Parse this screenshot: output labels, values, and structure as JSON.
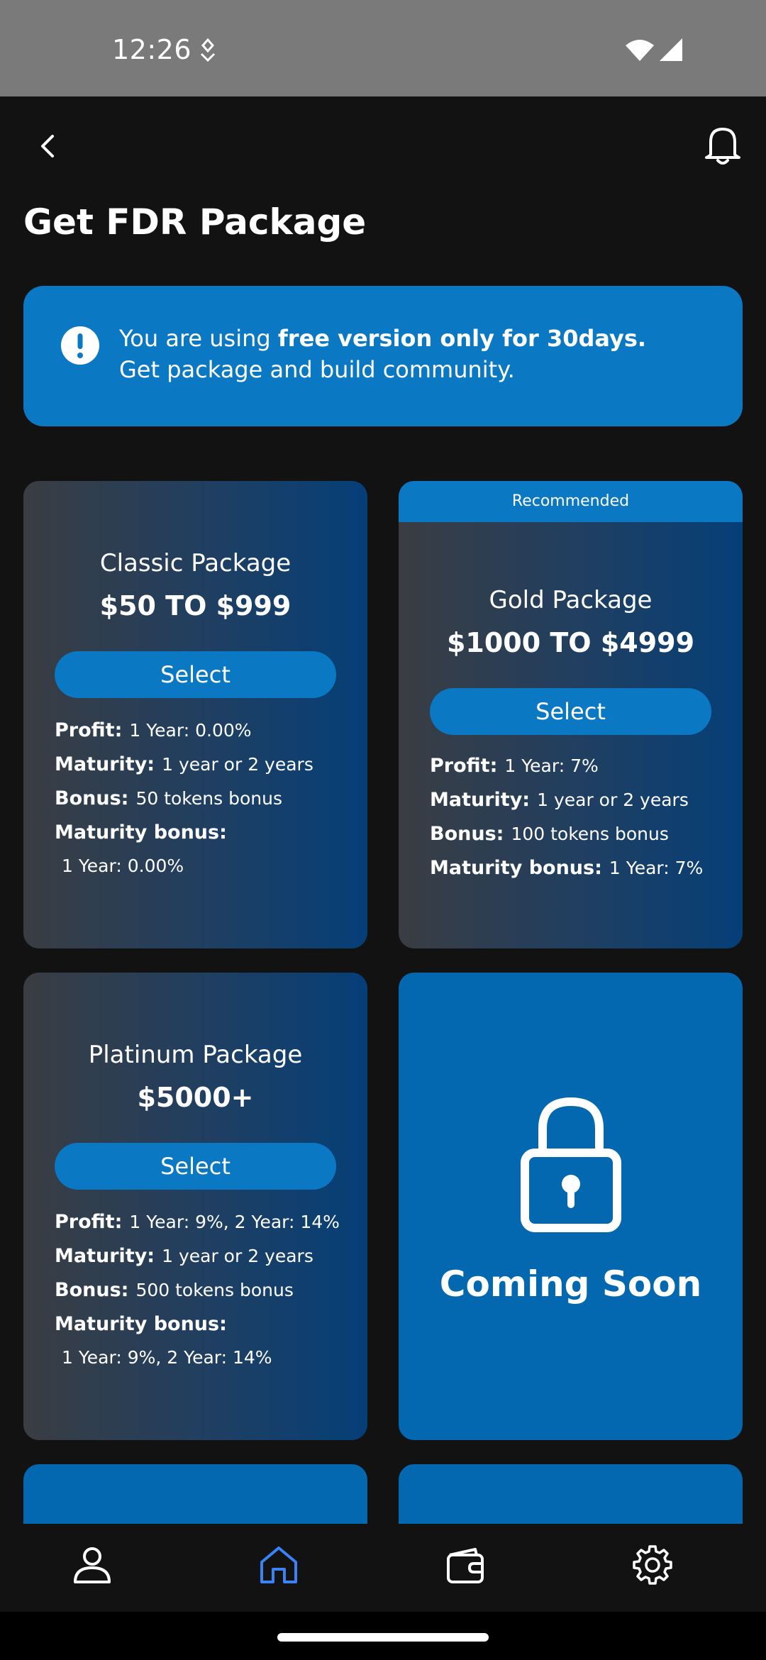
{
  "status_bar": {
    "time": "12:26"
  },
  "header": {
    "title": "Get FDR Package"
  },
  "banner": {
    "prefix": "You are using ",
    "highlight": "free version only for 30days.",
    "line2": "Get package and build community."
  },
  "packages": [
    {
      "name": "Classic Package",
      "price": "$50 TO $999",
      "select_label": "Select",
      "profit_label": "Profit:",
      "profit": "1 Year: 0.00%",
      "maturity_label": "Maturity:",
      "maturity": "1 year or 2 years",
      "bonus_label": "Bonus:",
      "bonus": "50 tokens bonus",
      "maturity_bonus_label": "Maturity bonus:",
      "maturity_bonus": "1 Year: 0.00%"
    },
    {
      "ribbon": "Recommended",
      "name": "Gold Package",
      "price": "$1000 TO $4999",
      "select_label": "Select",
      "profit_label": "Profit:",
      "profit": "1 Year: 7%",
      "maturity_label": "Maturity:",
      "maturity": "1 year or 2 years",
      "bonus_label": "Bonus:",
      "bonus": "100 tokens bonus",
      "maturity_bonus_label": "Maturity bonus:",
      "maturity_bonus": "1 Year: 7%"
    },
    {
      "name": "Platinum Package",
      "price": "$5000+",
      "select_label": "Select",
      "profit_label": "Profit:",
      "profit": "1 Year: 9%, 2 Year: 14%",
      "maturity_label": "Maturity:",
      "maturity": "1 year or 2 years",
      "bonus_label": "Bonus:",
      "bonus": "500 tokens bonus",
      "maturity_bonus_label": "Maturity bonus:",
      "maturity_bonus": "1 Year: 9%, 2 Year: 14%"
    }
  ],
  "coming_soon": {
    "label": "Coming Soon",
    "icon": "lock-icon"
  },
  "bottom_nav": {
    "items": [
      "profile-icon",
      "home-icon",
      "wallet-icon",
      "settings-icon"
    ],
    "active": "home-icon"
  },
  "colors": {
    "background": "#121212",
    "accent": "#0a78c2",
    "coming_soon_bg": "#0368b0",
    "active_nav": "#3b82f6"
  }
}
